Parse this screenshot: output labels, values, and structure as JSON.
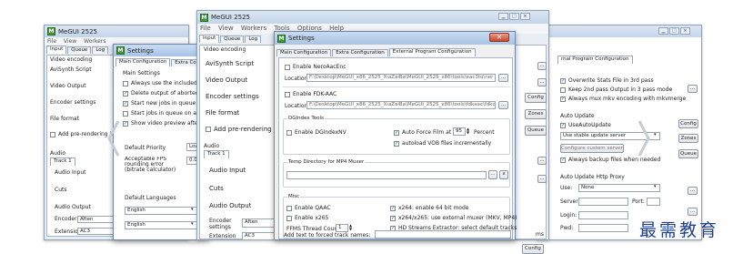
{
  "app_title": "MeGUI 2525",
  "app_icon": "M",
  "menu": [
    "File",
    "View",
    "Workers",
    "Tools",
    "Options",
    "Help"
  ],
  "main_tabs": [
    "Input",
    "Queue",
    "Log"
  ],
  "settings_title": "Settings",
  "settings_tabs": [
    "Main Configuration",
    "Extra Configuration",
    "External Program Configuration"
  ],
  "left_window": {
    "title": "MeGUI 2525",
    "menu": [
      "File",
      "View",
      "Workers"
    ],
    "tabs": [
      "Input",
      "Queue",
      "Log"
    ],
    "rows": [
      "Video encoding",
      "AviSynth Script",
      "Video Output",
      "Encoder settings",
      "File format",
      "Add pre-rendering job"
    ],
    "audio": "Audio",
    "track": "Track 1",
    "audio_rows": [
      "Audio Input",
      "Cuts",
      "Audio Output",
      "Encoder settings",
      "Extension"
    ],
    "ext_value": "AC3",
    "enc_value": "Aften"
  },
  "left_settings": {
    "title": "Settings",
    "tabs": [
      "Main Configuration",
      "Extra Configura"
    ],
    "main_settings": "Main Settings",
    "checks": [
      {
        "label": "Always use the included Avi",
        "checked": false
      },
      {
        "label": "Delete output of aborted jot",
        "checked": true
      },
      {
        "label": "Start new jobs in queue imn",
        "checked": true
      },
      {
        "label": "Start jobs in queue on appli",
        "checked": false
      },
      {
        "label": "Show video preview after Av",
        "checked": true
      }
    ],
    "default_priority": "Default Priority",
    "priority_value": "Low",
    "fps_label": "Acceptable FPS rounding error (bitrate calculator)",
    "fps_value": "0.0",
    "default_languages": "Default Languages",
    "lang1": "English",
    "lang2": "English"
  },
  "center_window": {
    "title": "MeGUI 2525",
    "menu": [
      "File",
      "View",
      "Workers",
      "Tools",
      "Options",
      "Help"
    ],
    "tabs": [
      "Input",
      "Queue",
      "Log"
    ],
    "rows": [
      "Video encoding",
      "AviSynth Script",
      "Video Output",
      "Encoder settings",
      "File format",
      "Add pre-rendering job"
    ],
    "audio": "Audio",
    "track": "Track 1",
    "audio_rows": [
      "Audio Input",
      "Cuts",
      "Audio Output",
      "Encoder settings",
      "Extension"
    ],
    "enc_value": "Aften",
    "ext_value": "AC3"
  },
  "ext_config": {
    "nero_label": "Enable NeroAacEnc",
    "nero_location_label": "Location",
    "nero_location": "F:\\Desktop\\MeGUI_x86_2525_XiaZaiBa\\MeGUI_2525_x86\\tools\\eac3to\\ner",
    "fdk_label": "Enable FDK-AAC",
    "fdk_location_label": "Location",
    "fdk_location": "F:\\Desktop\\MeGUI_x86_2525_XiaZaiBa\\MeGUI_2525_x86\\tools\\fdkaac\\fdkc",
    "dgindex_title": "DGIndex Tools",
    "dgindexnv_label": "Enable DGIndexNV",
    "autoforce_label": "Auto Force Film at",
    "autoforce_value": "95",
    "percent": "Percent",
    "autoload_label": "autoload VOB files incrementally",
    "temp_title": "Temp Directory for MP4 Muxer",
    "misc_title": "Misc",
    "qaac_label": "Enable QAAC",
    "x265_label": "Enable x265",
    "x264_64_label": "x264: enable 64 bit mode",
    "x264_external_label": "x264/x265: use external muxer (MKV, MP4)",
    "hd_streams_label": "HD Streams Extractor: select default tracks",
    "ffms_label": "FFMS Thread Count:",
    "ffms_value": "1",
    "forced_label": "Add text to forced track names:",
    "ellipsis": "...",
    "x_btn": "x"
  },
  "right_window": {
    "tab": "rnal Program Configuration",
    "checks": [
      {
        "label": "Overwrite Stats File in 3rd pass",
        "checked": true
      },
      {
        "label": "Keep 2nd pass Output in 3 pass mode",
        "checked": false
      },
      {
        "label": "Always mux mkv encoding with mkvmerge",
        "checked": true
      }
    ],
    "auto_update": "Auto Update",
    "use_auto_update": "UseAutoUpdate",
    "update_server": "Use stable update server",
    "configure_servers": "Configure custom servers...",
    "always_backup": "Always backup files when needed",
    "http_proxy": "Auto Update Http Proxy",
    "use_label": "Use:",
    "use_value": "None",
    "server_label": "Server:",
    "port_label": "Port:",
    "login_label": "Login:",
    "pwd_label": "Pwd:",
    "config_btn": "Config",
    "zones_btn": "Zones",
    "queue_btn": "Queue",
    "ellipsis": "..."
  },
  "center_side_buttons": {
    "config": "Config",
    "zones": "Zones",
    "queue": "Queue",
    "ms": "ms"
  },
  "watermark": "最需教育"
}
